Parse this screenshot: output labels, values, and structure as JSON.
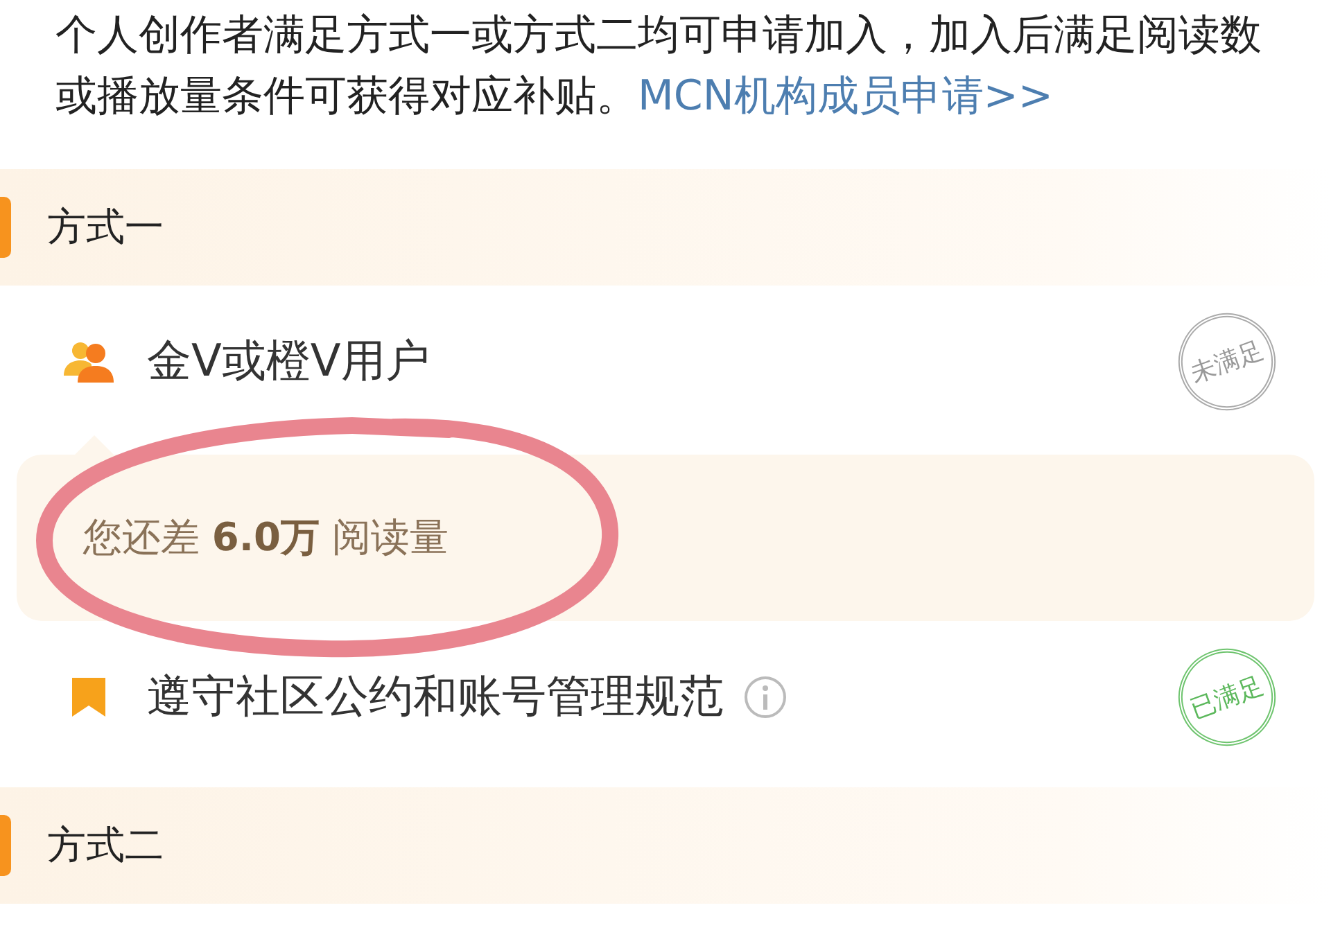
{
  "intro": {
    "text": "个人创作者满足方式一或方式二均可申请加入，加入后满足阅读数或播放量条件可获得对应补贴。",
    "link": "MCN机构成员申请>>"
  },
  "sections": [
    {
      "title": "方式一",
      "items": [
        {
          "kind": "people",
          "label": "金V或橙V用户",
          "info": false,
          "met": false,
          "stamp": "未满足",
          "hint": "您还差 **6.0万** 阅读量"
        },
        {
          "kind": "flag",
          "label": "遵守社区公约和账号管理规范",
          "info": true,
          "met": true,
          "stamp": "已满足"
        }
      ]
    },
    {
      "title": "方式二"
    }
  ]
}
